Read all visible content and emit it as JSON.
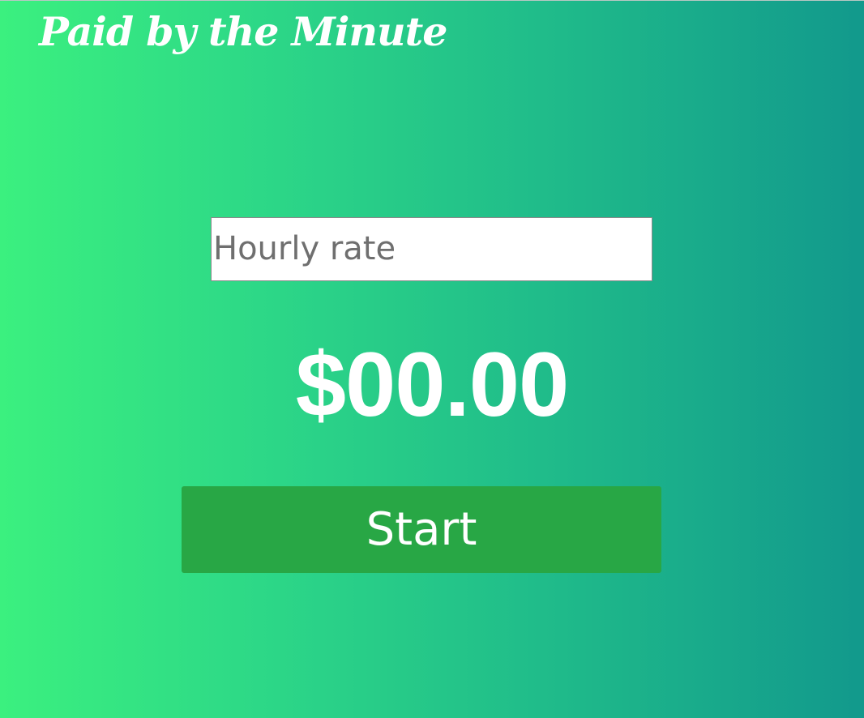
{
  "header": {
    "title": "Paid by the Minute"
  },
  "rate_input": {
    "value": "",
    "placeholder": "Hourly rate"
  },
  "earnings": {
    "display": "$00.00"
  },
  "controls": {
    "start_label": "Start"
  },
  "colors": {
    "gradient_start": "#3bf07f",
    "gradient_end": "#12998c",
    "button_background": "#28a745",
    "text": "#ffffff"
  }
}
